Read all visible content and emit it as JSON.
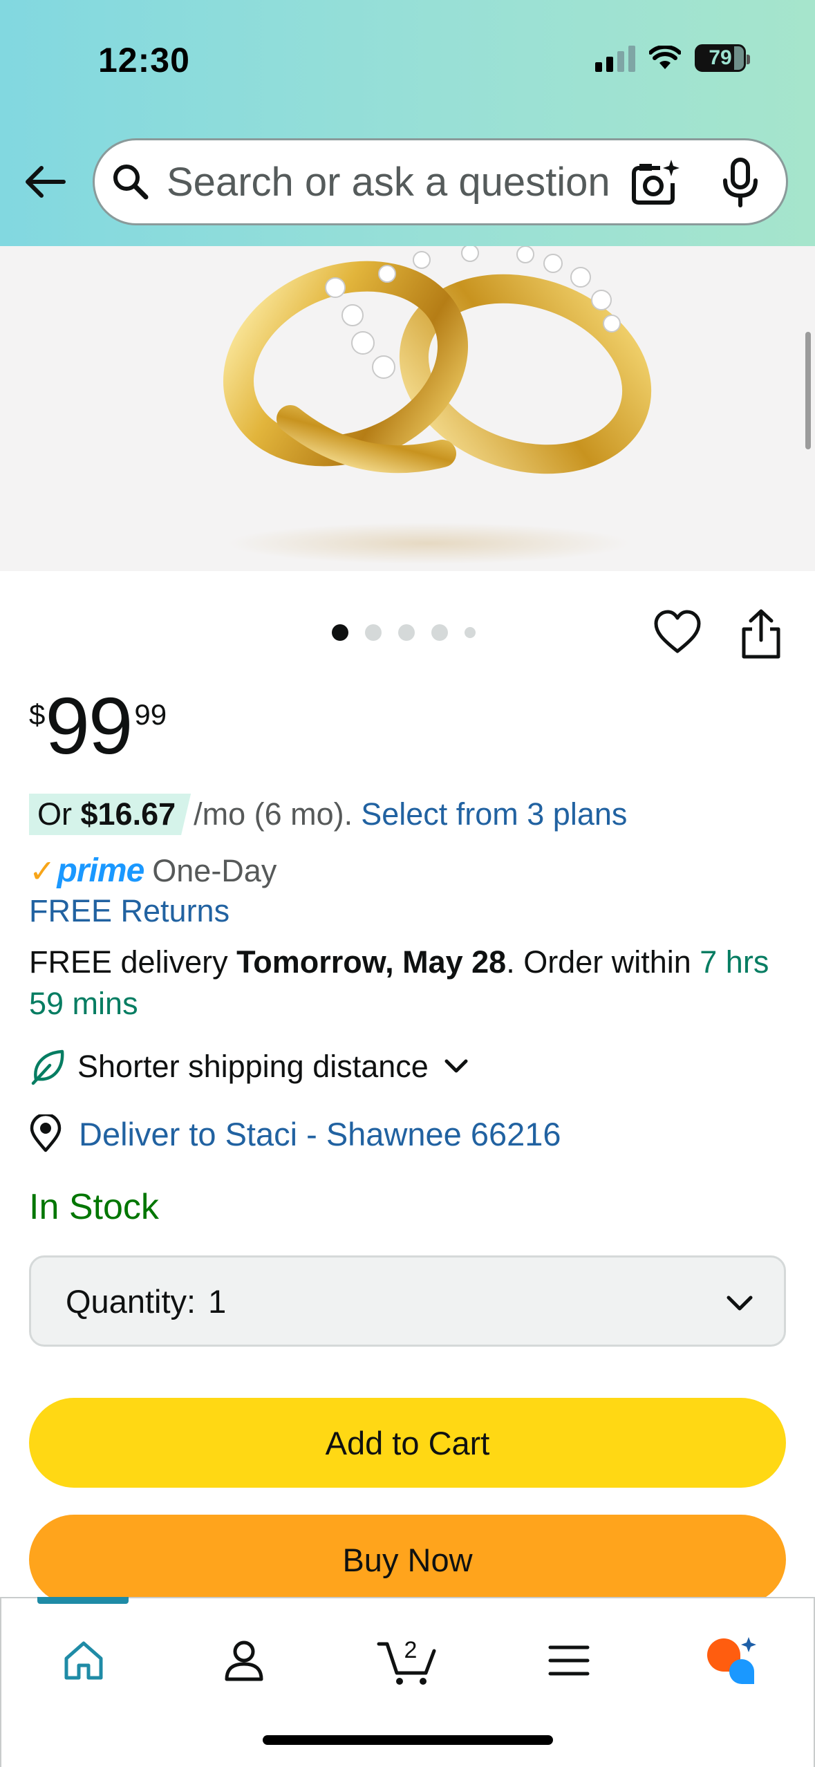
{
  "status_bar": {
    "time": "12:30",
    "battery": "79"
  },
  "search": {
    "placeholder": "Search or ask a question"
  },
  "carousel": {
    "total": 5,
    "active": 1
  },
  "price": {
    "currency": "$",
    "whole": "99",
    "fraction": "99"
  },
  "installment": {
    "prefix": "Or ",
    "amount": "$16.67",
    "terms": " /mo (6 mo).",
    "link": "Select from 3 plans"
  },
  "prime": {
    "brand": "prime",
    "speed": "One-Day"
  },
  "returns": {
    "label": "FREE Returns"
  },
  "delivery": {
    "prefix": "FREE delivery ",
    "date": "Tomorrow, May 28",
    "middle": ". Order within ",
    "countdown": "7 hrs 59 mins"
  },
  "shipping_note": {
    "label": "Shorter shipping distance"
  },
  "deliver_to": {
    "label": "Deliver to Staci - Shawnee 66216"
  },
  "stock": {
    "label": "In Stock"
  },
  "quantity": {
    "label": "Quantity:",
    "value": "1"
  },
  "buttons": {
    "add_to_cart": "Add to Cart",
    "buy_now": "Buy Now"
  },
  "bottom_nav": {
    "cart_count": "2",
    "active": "home"
  },
  "colors": {
    "header_start": "#82d8e0",
    "header_end": "#a6e5cc",
    "link": "#2162a1",
    "in_stock": "#007600",
    "add_to_cart": "#ffd814",
    "buy_now": "#ffa41c",
    "prime_blue": "#1a98ff",
    "nav_active": "#1f8ba6"
  },
  "icons": [
    "back-arrow-icon",
    "search-icon",
    "camera-sparkle-icon",
    "microphone-icon",
    "heart-icon",
    "share-icon",
    "leaf-icon",
    "chevron-down-icon",
    "location-pin-icon",
    "home-icon",
    "person-icon",
    "cart-icon",
    "menu-icon",
    "rufus-assistant-icon"
  ]
}
